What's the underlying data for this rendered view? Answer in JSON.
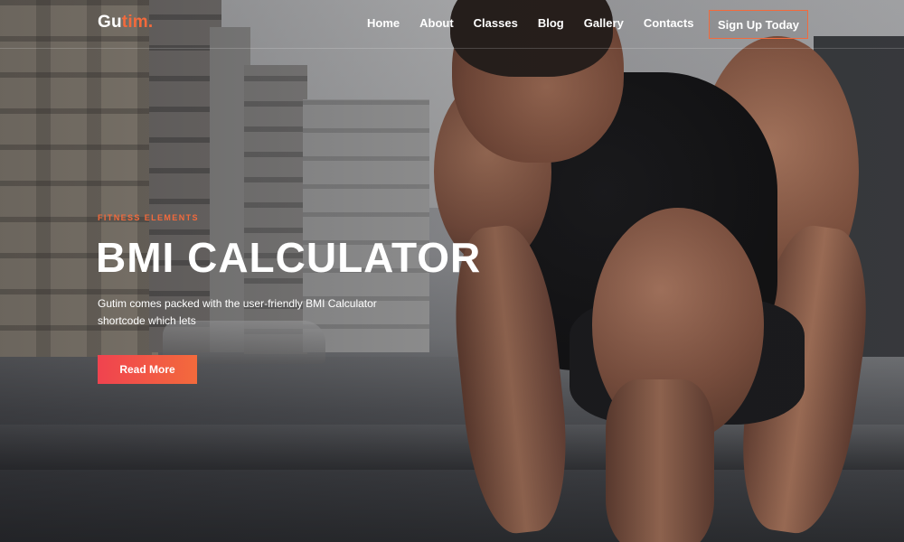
{
  "header": {
    "logo_main": "Gu",
    "logo_accent": "tim.",
    "nav": [
      "Home",
      "About",
      "Classes",
      "Blog",
      "Gallery",
      "Contacts"
    ],
    "signup_label": "Sign Up Today"
  },
  "hero": {
    "kicker": "FITNESS ELEMENTS",
    "title": "BMI CALCULATOR",
    "description": "Gutim comes packed with the user-friendly BMI Calculator shortcode which lets",
    "cta_label": "Read More"
  },
  "colors": {
    "accent": "#f36a3c",
    "cta_gradient_start": "#f0434f",
    "text": "#ffffff"
  }
}
